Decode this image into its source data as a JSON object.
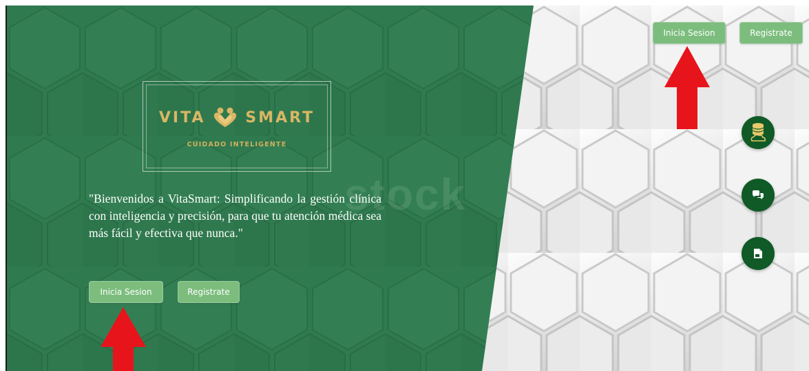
{
  "brand": {
    "word_left": "VITA",
    "word_right": "SMART",
    "tagline": "CUIDADO INTELIGENTE",
    "gold": "#d9b764"
  },
  "hero": {
    "welcome_text": "\"Bienvenidos a VitaSmart: Simplificando la gestión clínica con inteligencia y precisión, para que tu atención médica sea más fácil y efectiva que nunca.\""
  },
  "watermark": "stock",
  "hero_buttons": {
    "login_label": "Inicia Sesion",
    "register_label": "Registrate"
  },
  "header_buttons": {
    "login_label": "Inicia Sesion",
    "register_label": "Registrate"
  },
  "floating_actions": [
    {
      "icon": "database-cloud-icon"
    },
    {
      "icon": "chat-icon"
    },
    {
      "icon": "document-icon"
    }
  ],
  "annotations": {
    "arrow_color": "#e8141c"
  },
  "colors": {
    "green_panel": "#2f7a4f",
    "button": "#7cbd7e",
    "fab": "#0f5a26"
  }
}
